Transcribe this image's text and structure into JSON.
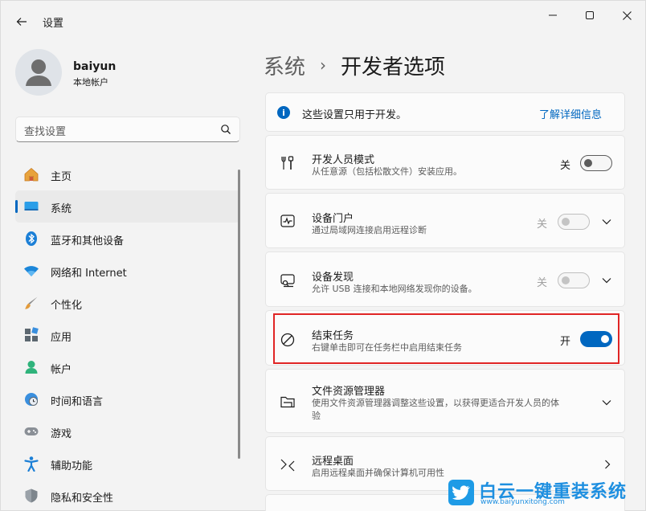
{
  "window": {
    "title": "设置"
  },
  "user": {
    "name": "baiyun",
    "account_type": "本地帐户"
  },
  "search": {
    "placeholder": "查找设置"
  },
  "nav": {
    "items": [
      {
        "label": "主页",
        "icon": "home-icon",
        "active": false
      },
      {
        "label": "系统",
        "icon": "system-icon",
        "active": true
      },
      {
        "label": "蓝牙和其他设备",
        "icon": "bluetooth-icon",
        "active": false
      },
      {
        "label": "网络和 Internet",
        "icon": "wifi-icon",
        "active": false
      },
      {
        "label": "个性化",
        "icon": "brush-icon",
        "active": false
      },
      {
        "label": "应用",
        "icon": "apps-icon",
        "active": false
      },
      {
        "label": "帐户",
        "icon": "account-icon",
        "active": false
      },
      {
        "label": "时间和语言",
        "icon": "clock-globe-icon",
        "active": false
      },
      {
        "label": "游戏",
        "icon": "gamepad-icon",
        "active": false
      },
      {
        "label": "辅助功能",
        "icon": "accessibility-icon",
        "active": false
      },
      {
        "label": "隐私和安全性",
        "icon": "shield-icon",
        "active": false
      }
    ]
  },
  "breadcrumb": {
    "parent": "系统",
    "separator": "›",
    "current": "开发者选项"
  },
  "info": {
    "text": "这些设置只用于开发。",
    "link": "了解详细信息"
  },
  "settings": [
    {
      "title": "开发人员模式",
      "desc": "从任意源（包括松散文件）安装应用。",
      "toggle_label": "关",
      "state": "off",
      "icon": "developer-tools-icon"
    },
    {
      "title": "设备门户",
      "desc": "通过局域网连接启用远程诊断",
      "toggle_label": "关",
      "state": "disabled",
      "icon": "pulse-icon"
    },
    {
      "title": "设备发现",
      "desc": "允许 USB 连接和本地网络发现你的设备。",
      "toggle_label": "关",
      "state": "disabled",
      "icon": "device-discovery-icon"
    },
    {
      "title": "结束任务",
      "desc": "右键单击即可在任务栏中启用结束任务",
      "toggle_label": "开",
      "state": "on",
      "icon": "block-icon"
    },
    {
      "title": "文件资源管理器",
      "desc_line1": "使用文件资源管理器调整这些设置，以获得更适合开发人员的体",
      "desc_line2": "验",
      "icon": "folder-icon"
    },
    {
      "title": "远程桌面",
      "desc": "启用远程桌面并确保计算机可用性",
      "icon": "remote-desktop-icon"
    }
  ],
  "watermark": {
    "title": "白云一键重装系统",
    "url": "www.baiyunxitong.com"
  },
  "colors": {
    "accent": "#0067c0",
    "highlight_border": "#e02525",
    "watermark": "#1e8fe0"
  }
}
